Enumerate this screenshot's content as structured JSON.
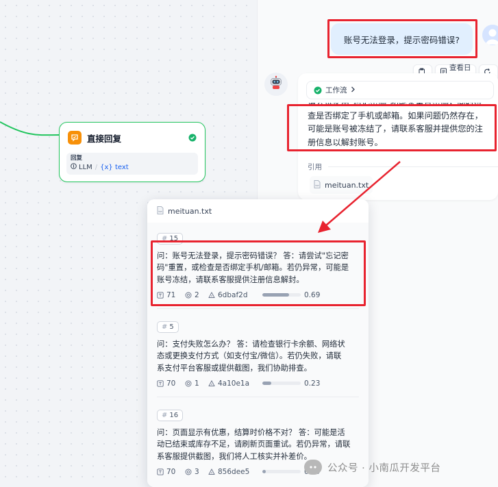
{
  "canvas": {
    "node": {
      "title": "直接回复",
      "reply_label": "回复",
      "var_source": "LLM",
      "var_name": "{x} text"
    }
  },
  "chat": {
    "user_message": "账号无法登录，提示密码错误?",
    "actions": {
      "view_log": "查看日志"
    },
    "workflow_label": "工作流",
    "answer_lines": [
      "请尝试使用\"忘记密码\"功能来重置密码，同时检",
      "查是否绑定了手机或邮箱。如果问题仍然存在，",
      "可能是账号被冻结了，请联系客服并提供您的注",
      "册信息以解封账号。"
    ],
    "citation_label": "引用",
    "citation_file": "meituan.txt"
  },
  "popup": {
    "file_name": "meituan.txt",
    "segments": [
      {
        "id": "15",
        "lines": [
          "问：账号无法登录，提示密码错误？ 答：请尝试\"忘记密",
          "码\"重置，或检查是否绑定手机/邮箱。若仍异常，可能是",
          "账号冻结，请联系客服提供注册信息解封。"
        ],
        "words": "71",
        "hits": "2",
        "hash": "6dbaf2d",
        "score": 0.69,
        "score_label": "0.69"
      },
      {
        "id": "5",
        "lines": [
          "问：支付失败怎么办？ 答：请检查银行卡余额、网络状",
          "态或更换支付方式（如支付宝/微信）。若仍失败，请联",
          "系支付平台客服或提供截图，我们协助排查。"
        ],
        "words": "70",
        "hits": "1",
        "hash": "4a10e1a",
        "score": 0.23,
        "score_label": "0.23"
      },
      {
        "id": "16",
        "lines": [
          "问：页面显示有优惠，结算时价格不对？ 答：可能是活",
          "动已结束或库存不足，请刷新页面重试。若仍异常，请联",
          "系客服提供截图，我们将人工核实并补差价。"
        ],
        "words": "70",
        "hits": "3",
        "hash": "856dee5",
        "score": 0.09,
        "score_label": "0.09"
      }
    ]
  },
  "watermark": {
    "text": "公众号 · 小南瓜开发平台"
  },
  "colors": {
    "highlight": "#e8232f",
    "node_border": "#22c55e",
    "node_icon": "#f79009",
    "user_bubble": "#e1effe",
    "variable": "#155eef"
  }
}
